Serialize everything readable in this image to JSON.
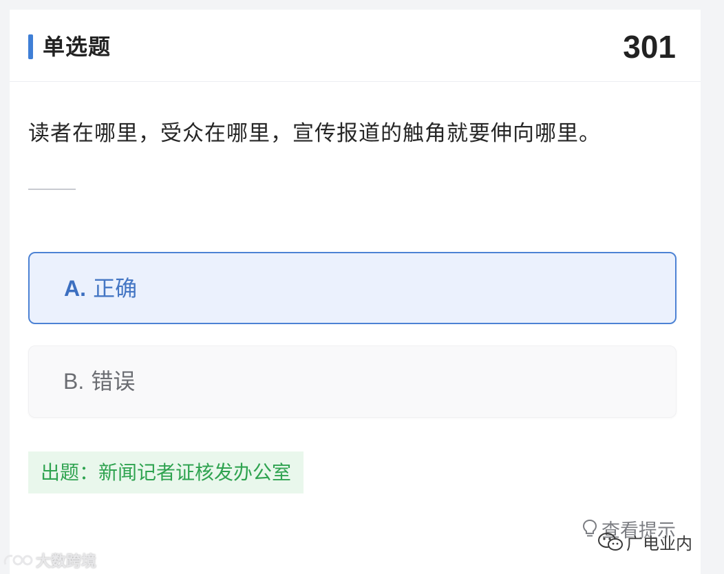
{
  "header": {
    "question_type": "单选题",
    "question_number": "301",
    "accent_color": "#3f7fd6"
  },
  "question": {
    "text": "读者在哪里，受众在哪里，宣传报道的触角就要伸向哪里。"
  },
  "options": [
    {
      "letter": "A.",
      "text": "正确",
      "selected": true
    },
    {
      "letter": "B.",
      "text": "错误",
      "selected": false
    }
  ],
  "source": {
    "text": "出题：新闻记者证核发办公室",
    "color": "#2fa350"
  },
  "hint": {
    "label": "查看提示",
    "icon": "lightbulb-icon"
  },
  "watermarks": {
    "left": "大数跨境",
    "right": "广电业内"
  }
}
